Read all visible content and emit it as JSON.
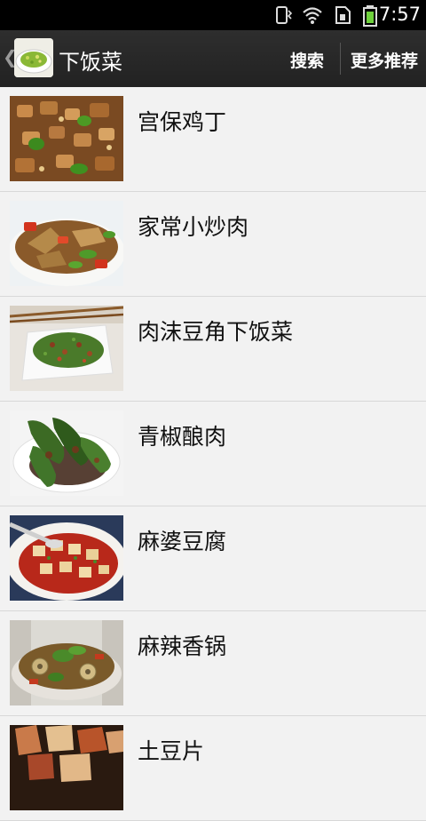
{
  "status_bar": {
    "time": "7:57",
    "icons": [
      "vibrate-icon",
      "wifi-icon",
      "sim-icon",
      "battery-icon"
    ]
  },
  "action_bar": {
    "title": "下饭菜",
    "search_label": "搜索",
    "more_label": "更多推荐"
  },
  "dishes": [
    {
      "name": "宫保鸡丁",
      "image": "kung-pao-chicken"
    },
    {
      "name": "家常小炒肉",
      "image": "stir-fried-pork"
    },
    {
      "name": "肉沫豆角下饭菜",
      "image": "minced-pork-green-beans"
    },
    {
      "name": "青椒酿肉",
      "image": "stuffed-green-peppers"
    },
    {
      "name": "麻婆豆腐",
      "image": "mapo-tofu"
    },
    {
      "name": "麻辣香锅",
      "image": "spicy-hot-pot"
    },
    {
      "name": "土豆片",
      "image": "potato-slices"
    }
  ]
}
